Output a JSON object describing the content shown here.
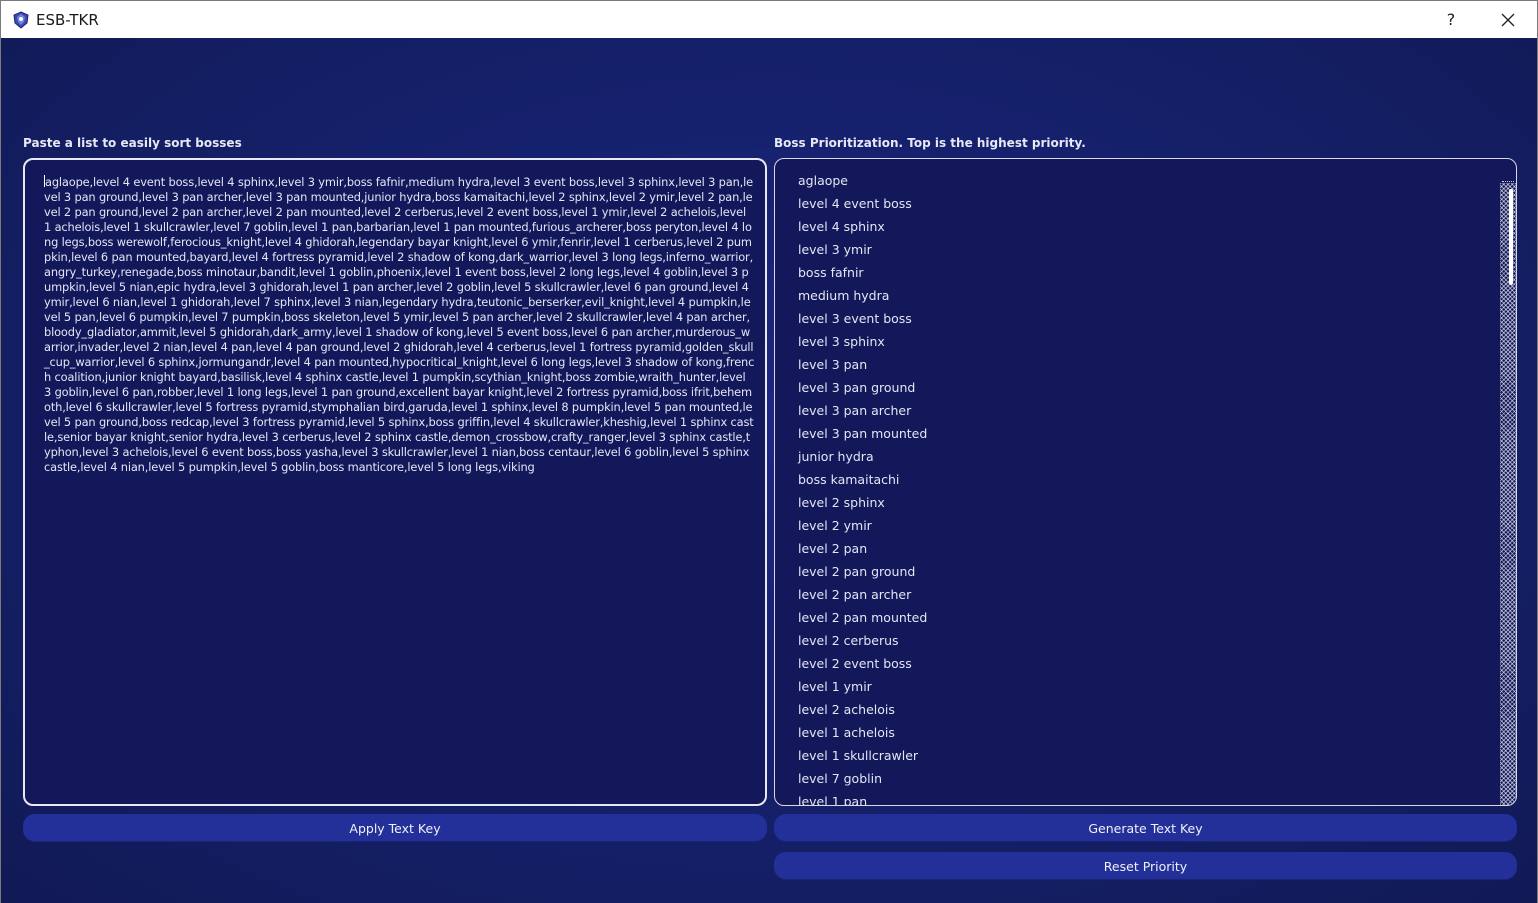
{
  "window": {
    "title": "ESB-TKR",
    "help_glyph": "?",
    "close_glyph": "✕"
  },
  "left_panel": {
    "label": "Paste a list to easily sort bosses",
    "text": "aglaope,level 4 event boss,level 4 sphinx,level 3 ymir,boss fafnir,medium hydra,level 3 event boss,level 3 sphinx,level 3 pan,level 3 pan ground,level 3 pan archer,level 3 pan mounted,junior hydra,boss kamaitachi,level 2 sphinx,level 2 ymir,level 2 pan,level 2 pan ground,level 2 pan archer,level 2 pan mounted,level 2 cerberus,level 2 event boss,level 1 ymir,level 2 achelois,level 1 achelois,level 1 skullcrawler,level 7 goblin,level 1 pan,barbarian,level 1 pan mounted,furious_archerer,boss peryton,level 4 long legs,boss werewolf,ferocious_knight,level 4 ghidorah,legendary bayar knight,level 6 ymir,fenrir,level 1 cerberus,level 2 pumpkin,level 6 pan mounted,bayard,level 4 fortress pyramid,level 2 shadow of kong,dark_warrior,level 3 long legs,inferno_warrior,angry_turkey,renegade,boss minotaur,bandit,level 1 goblin,phoenix,level 1 event boss,level 2 long legs,level 4 goblin,level 3 pumpkin,level 5 nian,epic hydra,level 3 ghidorah,level 1 pan archer,level 2 goblin,level 5 skullcrawler,level 6 pan ground,level 4 ymir,level 6 nian,level 1 ghidorah,level 7 sphinx,level 3 nian,legendary hydra,teutonic_berserker,evil_knight,level 4 pumpkin,level 5 pan,level 6 pumpkin,level 7 pumpkin,boss skeleton,level 5 ymir,level 5 pan archer,level 2 skullcrawler,level 4 pan archer,bloody_gladiator,ammit,level 5 ghidorah,dark_army,level 1 shadow of kong,level 5 event boss,level 6 pan archer,murderous_warrior,invader,level 2 nian,level 4 pan,level 4 pan ground,level 2 ghidorah,level 4 cerberus,level 1 fortress pyramid,golden_skull_cup_warrior,level 6 sphinx,jormungandr,level 4 pan mounted,hypocritical_knight,level 6 long legs,level 3 shadow of kong,french coalition,junior knight bayard,basilisk,level 4 sphinx castle,level 1 pumpkin,scythian_knight,boss zombie,wraith_hunter,level 3 goblin,level 6 pan,robber,level 1 long legs,level 1 pan ground,excellent bayar knight,level 2 fortress pyramid,boss ifrit,behemoth,level 6 skullcrawler,level 5 fortress pyramid,stymphalian bird,garuda,level 1 sphinx,level 8 pumpkin,level 5 pan mounted,level 5 pan ground,boss redcap,level 3 fortress pyramid,level 5 sphinx,boss griffin,level 4 skullcrawler,kheshig,level 1 sphinx castle,senior bayar knight,senior hydra,level 3 cerberus,level 2 sphinx castle,demon_crossbow,crafty_ranger,level 3 sphinx castle,typhon,level 3 achelois,level 6 event boss,boss yasha,level 3 skullcrawler,level 1 nian,boss centaur,level 6 goblin,level 5 sphinx castle,level 4 nian,level 5 pumpkin,level 5 goblin,boss manticore,level 5 long legs,viking"
  },
  "right_panel": {
    "label": "Boss Prioritization. Top is the highest priority.",
    "items": [
      "aglaope",
      "level 4 event boss",
      "level 4 sphinx",
      "level 3 ymir",
      "boss fafnir",
      "medium hydra",
      "level 3 event boss",
      "level 3 sphinx",
      "level 3 pan",
      "level 3 pan ground",
      "level 3 pan archer",
      "level 3 pan mounted",
      "junior hydra",
      "boss kamaitachi",
      "level 2 sphinx",
      "level 2 ymir",
      "level 2 pan",
      "level 2 pan ground",
      "level 2 pan archer",
      "level 2 pan mounted",
      "level 2 cerberus",
      "level 2 event boss",
      "level 1 ymir",
      "level 2 achelois",
      "level 1 achelois",
      "level 1 skullcrawler",
      "level 7 goblin",
      "level 1 pan"
    ]
  },
  "buttons": {
    "apply": "Apply Text Key",
    "generate": "Generate Text Key",
    "reset": "Reset Priority"
  },
  "colors": {
    "background": "#15206a",
    "panel": "#12185a",
    "button": "#24309a",
    "text": "#e4e6f4"
  }
}
